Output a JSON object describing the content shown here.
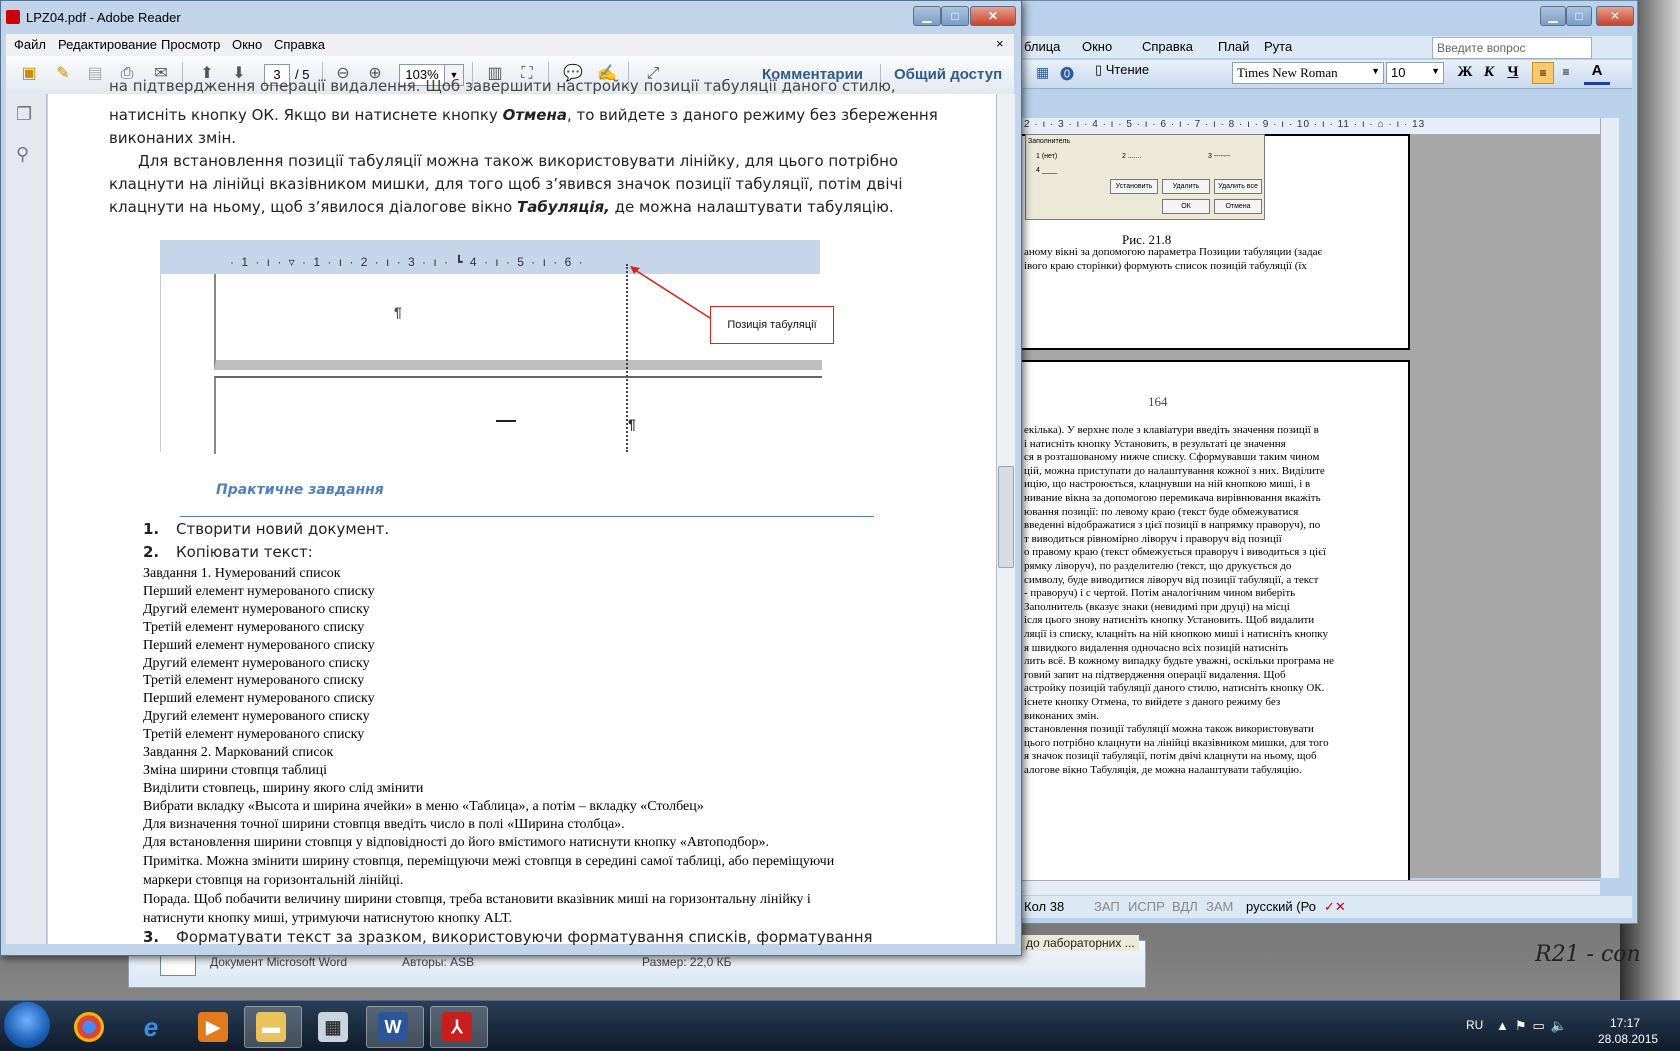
{
  "reader": {
    "title": "LPZ04.pdf - Adobe Reader",
    "menu": [
      "Файл",
      "Редактирование",
      "Просмотр",
      "Окно",
      "Справка"
    ],
    "menu_close": "×",
    "toolbar": {
      "page_current": "3",
      "page_total": "/ 5",
      "zoom": "103%",
      "comments_label": "Комментарии",
      "share_label": "Общий доступ"
    },
    "window_buttons": {
      "minimize": "▁",
      "maximize": "□",
      "close": "✕"
    }
  },
  "pdf": {
    "para_top_1": "на підтвердження операції видалення. Щоб завершити настройку позиції табуляції даного стилю,",
    "para_top_2": "натисніть кнопку ОК. Якщо ви натиснете кнопку ",
    "para_top_2_bold": "Отмена",
    "para_top_2_end": ", то вийдете з даного режиму без збереження",
    "para_top_3": "виконаних змін.",
    "para2_1": "Для встановлення позиції табуляції можна також використовувати лінійку, для цього потрібно",
    "para2_2": "клацнути на лінійці вказівником мишки, для того щоб з’явився значок позиції табуляції, потім двічі",
    "para2_3": "клацнути на ньому, щоб з’явилося діалогове вікно ",
    "para2_3_bold": "Табуляція,",
    "para2_3_end": " де можна налаштувати табуляцію.",
    "figure": {
      "ruler": "· 1 · ı · ▿ · 1 · ı · 2 · ı · 3 · ı · ┗ 4 · ı · 5 · ı · 6 ·",
      "callout": "Позиція табуляції",
      "pilcrow": "¶"
    },
    "section_title": "Практичне завдання",
    "list": [
      {
        "num": "1.",
        "text": "Створити новий документ."
      },
      {
        "num": "2.",
        "text": "Копіювати текст:"
      }
    ],
    "copy_lines": [
      "Завдання 1. Нумерований список",
      "Перший елемент нумерованого списку",
      "Другий елемент нумерованого списку",
      "Третій елемент нумерованого списку",
      "Перший елемент нумерованого списку",
      "Другий елемент нумерованого списку",
      "Третій елемент нумерованого списку",
      "Перший елемент нумерованого списку",
      "Другий елемент нумерованого списку",
      "Третій елемент нумерованого списку",
      "Завдання 2. Маркований список",
      "Зміна ширини стовпця таблиці",
      "Виділити стовпець, ширину якого слід змінити",
      "Вибрати вкладку «Высота и ширина ячейки» в меню «Таблица», а потім – вкладку «Столбец»",
      "Для визначення точної ширини стовпця введіть число в полі «Ширина столбца».",
      "Для встановлення ширини стовпця у відповідності до його вмістимого натиснути кнопку «Автоподбор»."
    ],
    "note_1": "Примітка. Можна змінити ширину стовпця, переміщуючи межі стовпця в середині самої таблиці, або переміщуючи",
    "note_2": "маркери стовпця на горизонтальній лінійці.",
    "tip_1": "Порада. Щоб побачити величину ширини стовпця, треба встановити вказівник миші на горизонтальну лінійку і",
    "tip_2": "натиснути кнопку миші, утримуючи натиснутою кнопку ALT.",
    "item3_num": "3.",
    "item3_text": "Форматувати текст за зразком, використовуючи форматування списків, форматування"
  },
  "word": {
    "menu": [
      "блица",
      "Окно",
      "Справка",
      "Плай",
      "Рута"
    ],
    "help_placeholder": "Введите вопрос",
    "reading": "Чтение",
    "font": "Times New Roman",
    "size": "10",
    "fmt": [
      "Ж",
      "К",
      "Ч"
    ],
    "ruler": "2 · ı · 3 · ı · 4 · ı · 5 · ı · 6 · ı · 7 · ı · 8 · ı · 9 · ı · 10 · ı · 11 · ı · ⌂ · ı · 13",
    "dialog": {
      "group": "Заполнитель",
      "opt1": "1 (нет)",
      "opt2": "2 .......",
      "opt3": "3 -------",
      "opt4": "4 ____",
      "btn_set": "Установить",
      "btn_del": "Удалить",
      "btn_del_all": "Удалить все",
      "btn_ok": "ОК",
      "btn_cancel": "Отмена"
    },
    "figure_caption": "Рис.  21.8",
    "page1_lines": [
      "аному вікні за допомогою параметра Позиции табуляции (задає",
      "івого краю сторінки) формують список позицій табуляції (їх"
    ],
    "page_number": "164",
    "page2_lines": [
      "екілька). У верхнє поле з клавіатури введіть значення позиції в",
      "і натисніть кнопку Установить, в результаті це значення",
      "ся в розташованому нижче списку. Сформувавши таким чином",
      "цій, можна приступати до налаштування кожної з них. Виділите",
      "ицію, що настроюється, клацнувши на ній кнопкою миші, і в",
      "нивание вікна за допомогою перемикача вирівнювання вкажіть",
      "ювання позиції: по левому краю (текст буде обмежуватися",
      "введенні відображатися з цієї позиції в напрямку праворуч), по",
      "т виводиться рівномірно ліворуч і праворуч від позиції",
      "о правому краю (текст обмежується праворуч і виводиться з цієї",
      "рямку ліворуч), по разделителю (текст, що друкується до",
      "символу, буде виводитися ліворуч від позиції табуляції, а текст",
      "- праворуч) і с чертой. Потім аналогічним чином виберіть",
      "Заполнитель (вказує знаки (невидимі при друці) на місці",
      "ісля цього знову натисніть кнопку Установить. Щоб видалити",
      "ляції із списку, клацніть на ній кнопкою миші і натисніть кнопку",
      "я швидкого видалення одночасно всіх позицій натисніть",
      "лить всё. В кожному випадку будьте уважні, оскільки програма не",
      "говий запит на підтвердження операції видалення. Щоб",
      "астройку позицій табуляції даного стилю, натисніть кнопку ОК.",
      "існете кнопку Отмена, то вийдете з даного режиму без",
      "виконаних змін.",
      "встановлення позиції табуляції можна також використовувати",
      "цього потрібно клацнути на лінійці вказівником мишки, для того",
      "я значок позиції табуляції, потім двічі клацнути на ньому, щоб",
      "алогове вікно Табуляція, де можна налаштувати табуляцію."
    ],
    "status": {
      "col": "Кол  38",
      "rec": "ЗАП",
      "trk": "ИСПР",
      "ext": "ВДЛ",
      "ovr": "ЗАМ",
      "lang": "русский (Ро"
    }
  },
  "explorer": {
    "doctype": "Документ Microsoft Word",
    "authors": "Авторы:  ASB",
    "size": "Размер:  22,0 КБ",
    "link": "до лабораторних ..."
  },
  "taskbar": {
    "lang": "RU",
    "time": "17:17",
    "date": "28.08.2015"
  }
}
